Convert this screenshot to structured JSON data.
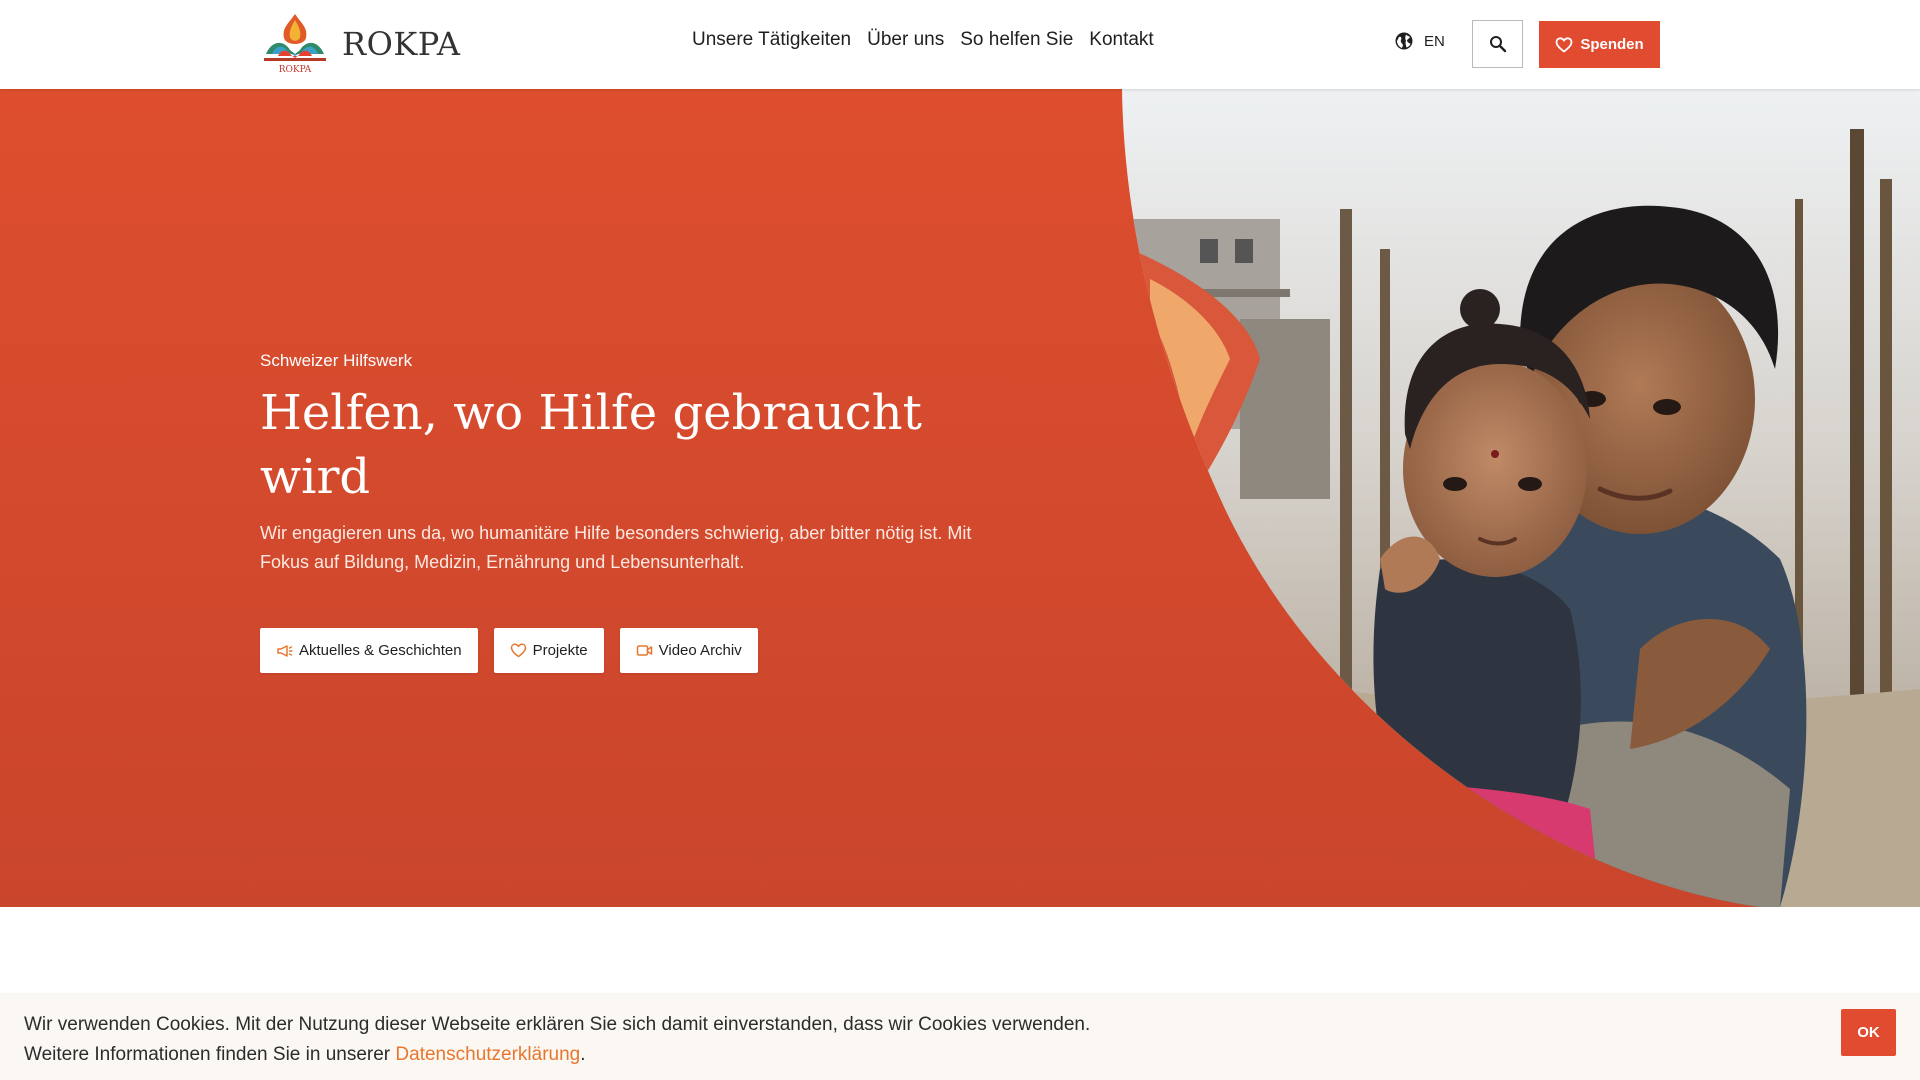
{
  "brand": {
    "name": "ROKPA",
    "logo_caption": "ROKPA",
    "accent": "#e14b2f"
  },
  "nav": {
    "items": [
      {
        "label": "Unsere Tätigkeiten"
      },
      {
        "label": "Über uns"
      },
      {
        "label": "So helfen Sie"
      },
      {
        "label": "Kontakt"
      }
    ]
  },
  "header": {
    "language": "EN",
    "language_icon": "globe-icon",
    "search_icon": "search-icon",
    "donate_label": "Spenden",
    "donate_icon": "heart-icon"
  },
  "hero": {
    "kicker": "Schweizer Hilfswerk",
    "headline": "Helfen, wo Hilfe gebraucht wird",
    "lead": "Wir engagieren uns da, wo humanitäre Hilfe besonders schwierig, aber bitter nötig ist. Mit Fokus auf Bildung, Medizin, Ernährung und Lebensunterhalt.",
    "background_color": "#d84b2e",
    "buttons": [
      {
        "label": "Aktuelles & Geschichten",
        "icon": "megaphone-icon"
      },
      {
        "label": "Projekte",
        "icon": "heart-icon"
      },
      {
        "label": "Video Archiv",
        "icon": "video-icon"
      }
    ]
  },
  "cookie": {
    "line1": "Wir verwenden Cookies. Mit der Nutzung dieser Webseite erklären Sie sich damit einverstanden, dass wir Cookies verwenden.",
    "line2_prefix": "Weitere Informationen finden Sie in unserer ",
    "link_label": "Datenschutzerklärung",
    "line2_suffix": ".",
    "ok_label": "OK"
  }
}
